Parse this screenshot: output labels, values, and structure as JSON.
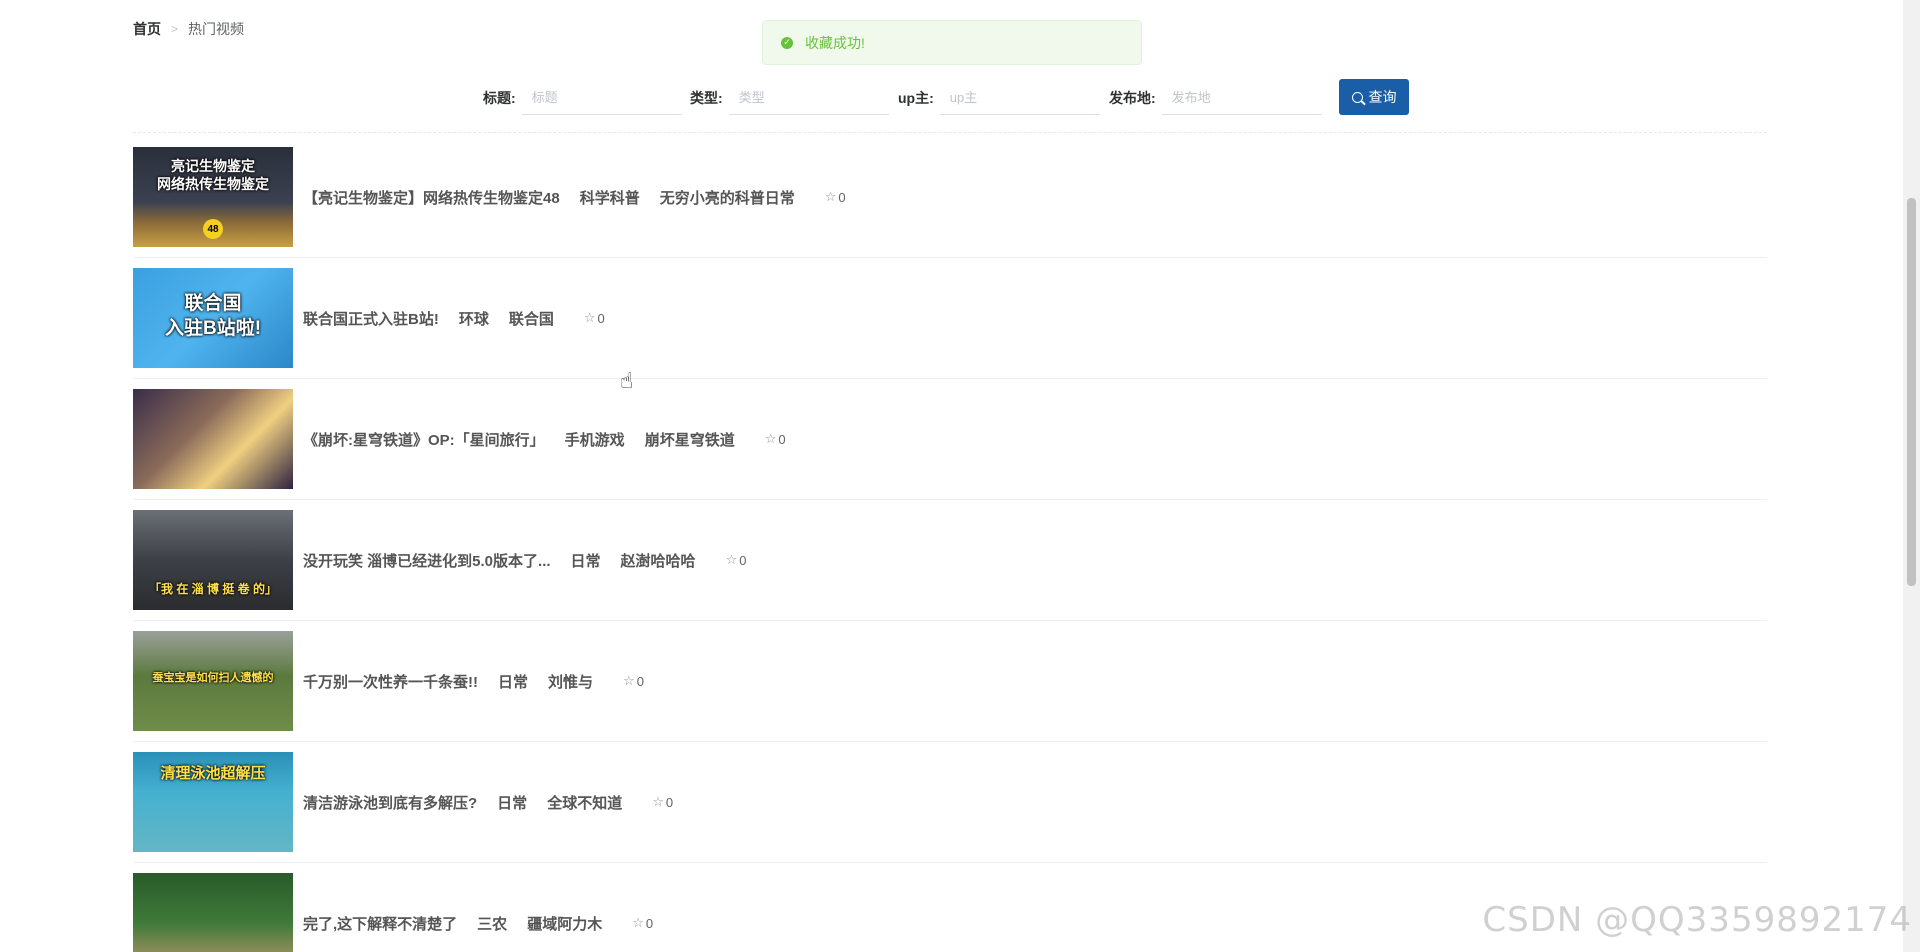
{
  "breadcrumb": {
    "home": "首页",
    "separator": ">",
    "current": "热门视频"
  },
  "toast": {
    "icon": "check-circle-icon",
    "message": "收藏成功!",
    "color": "#67c23a"
  },
  "search": {
    "title_label": "标题:",
    "title_placeholder": "标题",
    "type_label": "类型:",
    "type_placeholder": "类型",
    "up_label": "up主:",
    "up_placeholder": "up主",
    "place_label": "发布地:",
    "place_placeholder": "发布地",
    "query_label": "查询",
    "button_color": "#1a5ea8"
  },
  "videos": [
    {
      "title": "【亮记生物鉴定】网络热传生物鉴定48",
      "type": "科学科普",
      "uploader": "无穷小亮的科普日常",
      "favorites": "0",
      "thumb_text": "亮记生物鉴定\n网络热传生物鉴定",
      "thumb_badge": "48"
    },
    {
      "title": "联合国正式入驻B站!",
      "type": "环球",
      "uploader": "联合国",
      "favorites": "0",
      "thumb_text": "联合国\n入驻B站啦!"
    },
    {
      "title": "《崩坏:星穹铁道》OP:「星间旅行」",
      "type": "手机游戏",
      "uploader": "崩坏星穹铁道",
      "favorites": "0",
      "thumb_text": ""
    },
    {
      "title": "没开玩笑 淄博已经进化到5.0版本了...",
      "type": "日常",
      "uploader": "赵澍哈哈哈",
      "favorites": "0",
      "thumb_text": "「我 在 淄 博 挺 卷 的」"
    },
    {
      "title": "千万别一次性养一千条蚕!!",
      "type": "日常",
      "uploader": "刘惟与",
      "favorites": "0",
      "thumb_text": "蚕宝宝是如何扫人遗憾的"
    },
    {
      "title": "清洁游泳池到底有多解压?",
      "type": "日常",
      "uploader": "全球不知道",
      "favorites": "0",
      "thumb_text": "清理泳池超解压"
    },
    {
      "title": "完了,这下解释不清楚了",
      "type": "三农",
      "uploader": "疆域阿力木",
      "favorites": "0",
      "thumb_text": ""
    }
  ],
  "watermark": "CSDN @QQ3359892174"
}
